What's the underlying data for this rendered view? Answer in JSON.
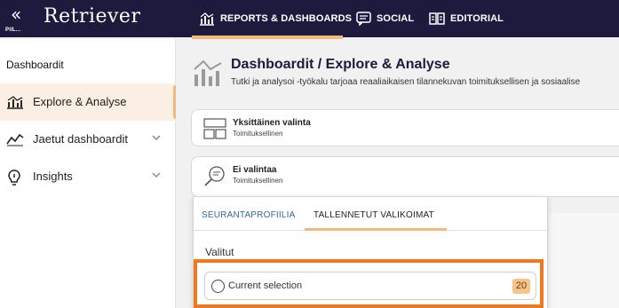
{
  "topbar": {
    "collapse_label": "PIIL...",
    "brand": "Retriever",
    "nav": [
      {
        "label": "REPORTS & DASHBOARDS",
        "icon": "bar-chart-icon",
        "active": true
      },
      {
        "label": "SOCIAL",
        "icon": "chat-icon",
        "active": false
      },
      {
        "label": "EDITORIAL",
        "icon": "book-icon",
        "active": false
      }
    ]
  },
  "sidebar": {
    "header": "Dashboardit",
    "items": [
      {
        "label": "Explore & Analyse",
        "icon": "bar-chart-icon",
        "active": true
      },
      {
        "label": "Jaetut dashboardit",
        "icon": "trend-line-icon",
        "expandable": true
      },
      {
        "label": "Insights",
        "icon": "lightbulb-icon",
        "expandable": true
      }
    ]
  },
  "main": {
    "title": "Dashboardit / Explore & Analyse",
    "description": "Tutki ja analysoi -työkalu tarjoaa reaaliaikaisen tilannekuvan toimituksellisen ja sosiaalise",
    "cards": [
      {
        "title": "Yksittäinen valinta",
        "subtitle": "Toimituksellinen",
        "icon": "layout-icon"
      },
      {
        "title": "Ei valintaa",
        "subtitle": "Toimituksellinen",
        "icon": "search-icon"
      }
    ],
    "panel": {
      "tabs": [
        {
          "label": "SEURANTAPROFIILIA",
          "active": false
        },
        {
          "label": "TALLENNETUT VALIKOIMAT",
          "active": true
        }
      ],
      "section_label": "Valitut",
      "selection": {
        "label": "Current selection",
        "count": "20"
      }
    }
  },
  "colors": {
    "topbar": "#1c1a3d",
    "accent": "#f5b87a",
    "highlight_border": "#f0781e",
    "link": "#2f6aa3"
  }
}
